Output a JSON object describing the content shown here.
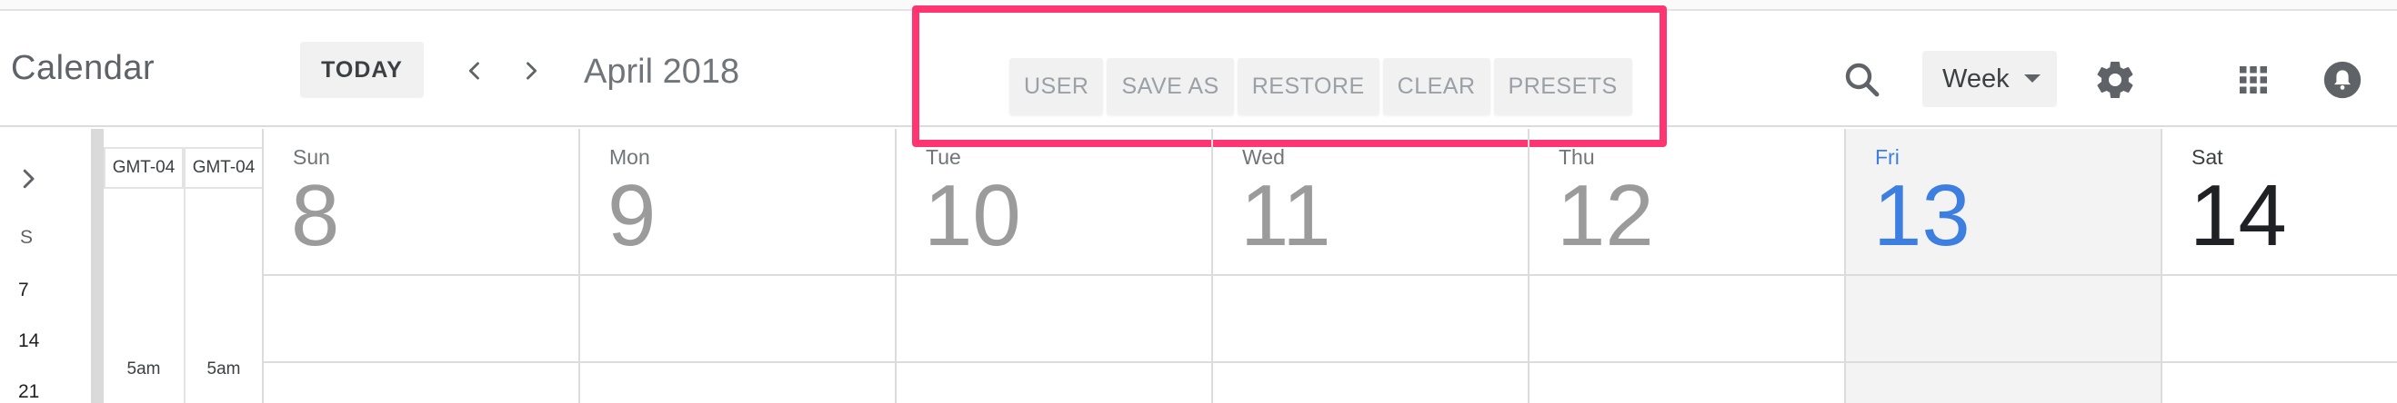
{
  "app": {
    "title": "Calendar"
  },
  "header": {
    "today_label": "TODAY",
    "month_label": "April 2018",
    "view_label": "Week"
  },
  "toolbar": {
    "buttons": [
      "USER",
      "SAVE AS",
      "RESTORE",
      "CLEAR",
      "PRESETS"
    ]
  },
  "icons": {
    "prev": "chevron-left-icon",
    "next": "chevron-right-icon",
    "search": "search-icon",
    "settings": "gear-icon",
    "apps": "apps-grid-icon",
    "notifications": "bell-icon",
    "mini_nav": "chevron-right-icon"
  },
  "mini_nav": {
    "weekday_initial": "S",
    "days": [
      "7",
      "14",
      "21"
    ]
  },
  "timezones": [
    "GMT-04",
    "GMT-04"
  ],
  "times": [
    "5am",
    "5am"
  ],
  "days": [
    {
      "name": "Sun",
      "number": "8"
    },
    {
      "name": "Mon",
      "number": "9"
    },
    {
      "name": "Tue",
      "number": "10"
    },
    {
      "name": "Wed",
      "number": "11"
    },
    {
      "name": "Thu",
      "number": "12"
    },
    {
      "name": "Fri",
      "number": "13"
    },
    {
      "name": "Sat",
      "number": "14"
    }
  ],
  "colors": {
    "highlight": "#ff3572",
    "today": "#3c7fe0",
    "past_day": "#9b9b9b"
  }
}
